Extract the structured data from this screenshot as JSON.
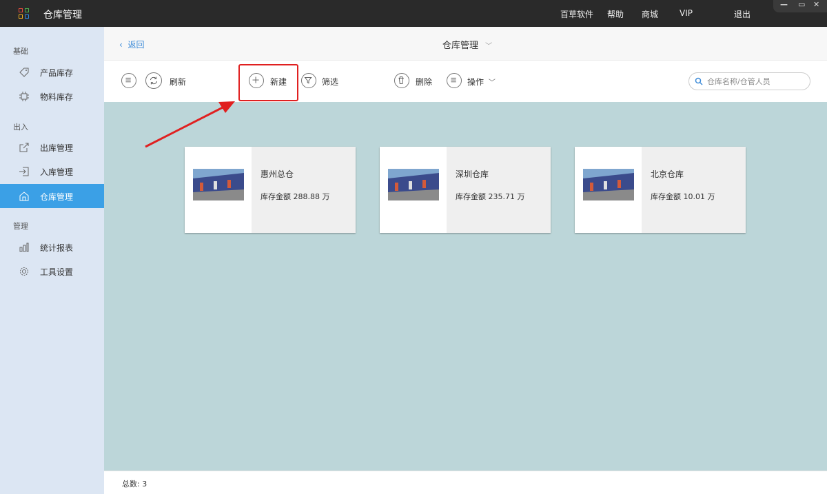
{
  "titlebar": {
    "app_title": "仓库管理",
    "nav": [
      "百草软件",
      "帮助",
      "商城",
      "VIP",
      "退出"
    ],
    "controls": [
      "—",
      "▭",
      "✕"
    ]
  },
  "sidebar": {
    "sections": [
      {
        "title": "基础",
        "items": [
          {
            "label": "产品库存",
            "icon": "tag-icon"
          },
          {
            "label": "物料库存",
            "icon": "chip-icon"
          }
        ]
      },
      {
        "title": "出入",
        "items": [
          {
            "label": "出库管理",
            "icon": "export-icon"
          },
          {
            "label": "入库管理",
            "icon": "import-icon"
          },
          {
            "label": "仓库管理",
            "icon": "warehouse-icon",
            "active": true
          }
        ]
      },
      {
        "title": "管理",
        "items": [
          {
            "label": "统计报表",
            "icon": "bar-chart-icon"
          },
          {
            "label": "工具设置",
            "icon": "gear-icon"
          }
        ]
      }
    ]
  },
  "header": {
    "back": "返回",
    "title": "仓库管理"
  },
  "toolbar": {
    "refresh": "刷新",
    "new": "新建",
    "filter": "筛选",
    "delete": "删除",
    "operate": "操作",
    "search_placeholder": "仓库名称/仓管人员"
  },
  "warehouses": [
    {
      "name": "惠州总仓",
      "amount": "库存金额  288.88 万"
    },
    {
      "name": "深圳仓库",
      "amount": "库存金额  235.71 万"
    },
    {
      "name": "北京仓库",
      "amount": "库存金额  10.01 万"
    }
  ],
  "footer": {
    "total": "总数:  3"
  },
  "colors": {
    "accent": "#3ba0e6",
    "highlight": "#e02020",
    "content_bg": "#bcd6d9"
  }
}
